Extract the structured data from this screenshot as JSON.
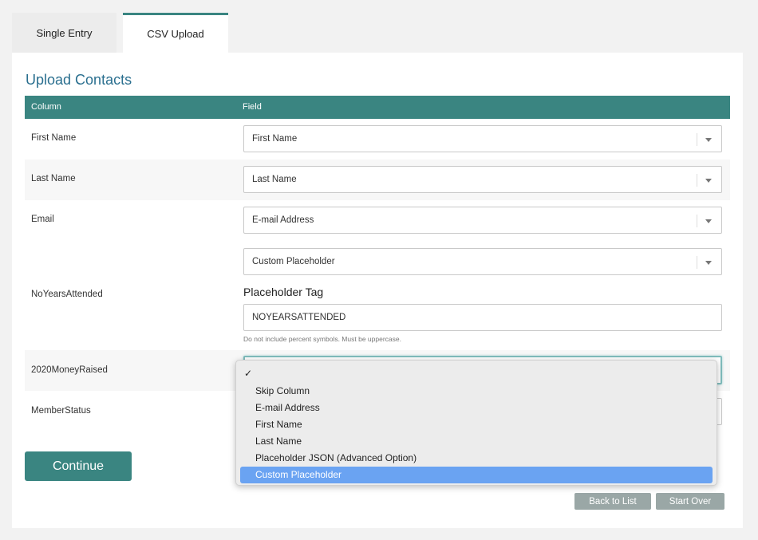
{
  "tabs": [
    {
      "label": "Single Entry"
    },
    {
      "label": "CSV Upload"
    }
  ],
  "title": "Upload Contacts",
  "table": {
    "col_header": "Column",
    "field_header": "Field",
    "rows": [
      {
        "column": "First Name",
        "field": "First Name"
      },
      {
        "column": "Last Name",
        "field": "Last Name"
      },
      {
        "column": "Email",
        "field": "E-mail Address"
      },
      {
        "column": "NoYearsAttended",
        "field": "Custom Placeholder"
      },
      {
        "column": "2020MoneyRaised",
        "field": ""
      },
      {
        "column": "MemberStatus",
        "field": ""
      }
    ]
  },
  "placeholder": {
    "label": "Placeholder Tag",
    "value": "NOYEARSATTENDED",
    "help": "Do not include percent symbols. Must be uppercase."
  },
  "buttons": {
    "continue": "Continue",
    "back_to_list": "Back to List",
    "start_over": "Start Over"
  },
  "dropdown": {
    "check": "✓",
    "options": [
      "Skip Column",
      "E-mail Address",
      "First Name",
      "Last Name",
      "Placeholder JSON (Advanced Option)",
      "Custom Placeholder"
    ],
    "highlighted": "Custom Placeholder"
  },
  "colors": {
    "accent": "#3a8581",
    "title": "#2a6f8f",
    "highlight": "#6aa3f2"
  }
}
